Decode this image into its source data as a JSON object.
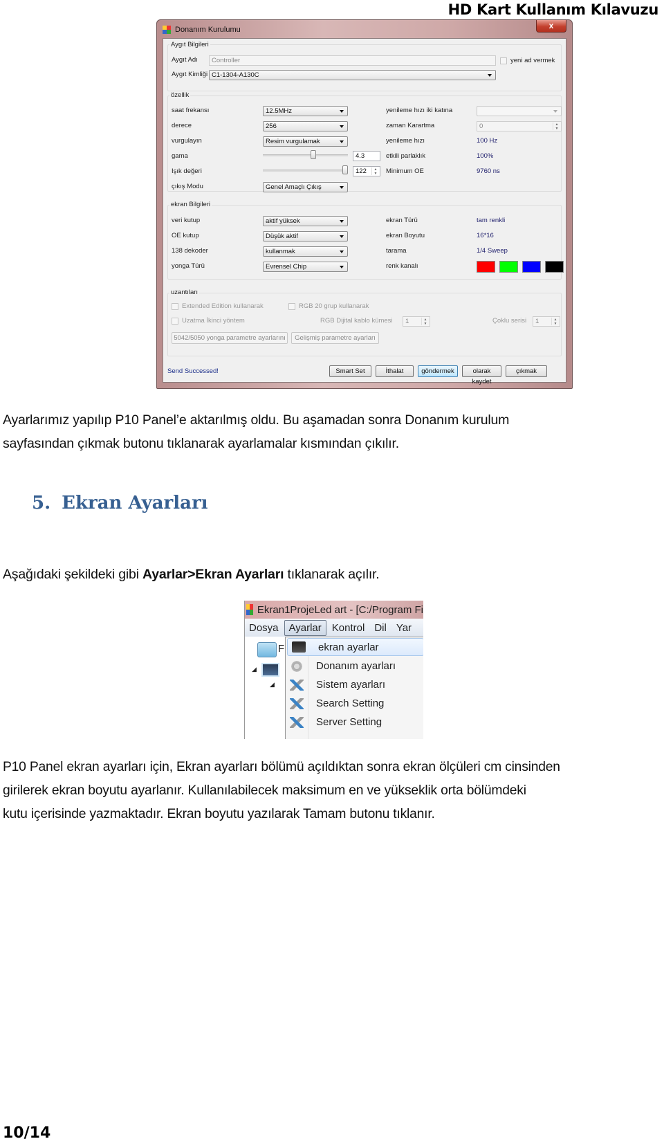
{
  "header": {
    "title": "HD Kart Kullanım Kılavuzu"
  },
  "dialog": {
    "title": "Donanım Kurulumu",
    "close_label": "x",
    "device_info": {
      "group_label": "Aygıt Bilgileri",
      "name_label": "Aygıt Adı",
      "name_value": "Controller",
      "rename_label": "yeni ad vermek",
      "id_label": "Aygıt Kimliği",
      "id_value": "C1-1304-A130C"
    },
    "properties": {
      "group_label": "özellik",
      "clock_label": "saat frekansı",
      "clock_value": "12.5MHz",
      "grade_label": "derece",
      "grade_value": "256",
      "emphasis_label": "vurgulayın",
      "emphasis_value": "Resim vurgulamak",
      "gamma_label": "gama",
      "gamma_value": "4.3",
      "gamma_slider_fraction": 0.6,
      "light_label": "Işık değeri",
      "light_value": "122",
      "light_slider_fraction": 1.0,
      "output_label": "çıkış Modu",
      "output_value": "Genel Amaçlı Çıkış",
      "refresh_double_label": "yenileme hızı iki katına",
      "refresh_double_value": "",
      "blanking_label": "zaman Karartma",
      "blanking_value": "0",
      "refresh_label": "yenileme hızı",
      "refresh_value": "100 Hz",
      "brightness_label": "etkili parlaklık",
      "brightness_value": "100%",
      "min_oe_label": "Minimum OE",
      "min_oe_value": "9760 ns"
    },
    "screen_info": {
      "group_label": "ekran Bilgileri",
      "data_pol_label": "veri kutup",
      "data_pol_value": "aktif yüksek",
      "oe_pol_label": "OE kutup",
      "oe_pol_value": "Düşük aktif",
      "decoder_label": "138 dekoder",
      "decoder_value": "kullanmak",
      "chip_label": "yonga Türü",
      "chip_value": "Evrensel Chip",
      "screen_type_label": "ekran Türü",
      "screen_type_value": "tam renkli",
      "screen_size_label": "ekran Boyutu",
      "screen_size_value": "16*16",
      "scan_label": "tarama",
      "scan_value": "1/4 Sweep",
      "color_channel_label": "renk kanalı",
      "color_channels": [
        "#ff0000",
        "#00ff00",
        "#0000ff",
        "#000000"
      ]
    },
    "extensions": {
      "group_label": "uzantıları",
      "extended_label": "Extended Edition kullanarak",
      "rgb20_label": "RGB 20 grup kullanarak",
      "second_method_label": "Uzatma İkinci yöntem",
      "rgb_cable_label": "RGB Dijital kablo kümesi",
      "rgb_cable_value": "1",
      "multi_series_label": "Çoklu serisi",
      "multi_series_value": "1",
      "chip_params_button": "5042/5050 yonga parametre ayarlarını",
      "advanced_params_button": "Gelişmiş parametre ayarları"
    },
    "status": "Send Successed!",
    "buttons": {
      "smart_set": "Smart Set",
      "import": "İthalat",
      "send": "göndermek",
      "save_as": "olarak kaydet",
      "exit": "çıkmak"
    }
  },
  "body": {
    "para1_line1": "Ayarlarımız yapılıp P10 Panel’e aktarılmış oldu. Bu aşamadan sonra Donanım kurulum",
    "para1_line2": "sayfasından çıkmak butonu tıklanarak ayarlamalar kısmından çıkılır.",
    "section_number": "5.",
    "section_title": "Ekran Ayarları",
    "para2_pre": "Aşağıdaki şekildeki gibi ",
    "para2_bold": "Ayarlar>Ekran Ayarları",
    "para2_post": " tıklanarak açılır.",
    "para3_line1": "P10 Panel ekran ayarları için, Ekran ayarları bölümü açıldıktan sonra ekran ölçüleri cm cinsinden",
    "para3_line2": "girilerek ekran boyutu ayarlanır. Kullanılabilecek maksimum en ve yükseklik orta bölümdeki",
    "para3_line3": "kutu içerisinde yazmaktadır. Ekran boyutu yazılarak Tamam butonu tıklanır."
  },
  "menu_shot": {
    "window_title": "Ekran1ProjeLed art - [C:/Program Fi",
    "menubar": [
      "Dosya",
      "Ayarlar",
      "Kontrol",
      "Dil",
      "Yar"
    ],
    "toolbar_partial": "F",
    "items": [
      {
        "label": "ekran ayarlar",
        "icon": "monitor-icon"
      },
      {
        "label": "Donanım ayarları",
        "icon": "gear-icon"
      },
      {
        "label": "Sistem ayarları",
        "icon": "tools-icon"
      },
      {
        "label": "Search Setting",
        "icon": "tools-icon"
      },
      {
        "label": "Server Setting",
        "icon": "tools-icon"
      }
    ]
  },
  "footer": {
    "page": "10/14"
  }
}
